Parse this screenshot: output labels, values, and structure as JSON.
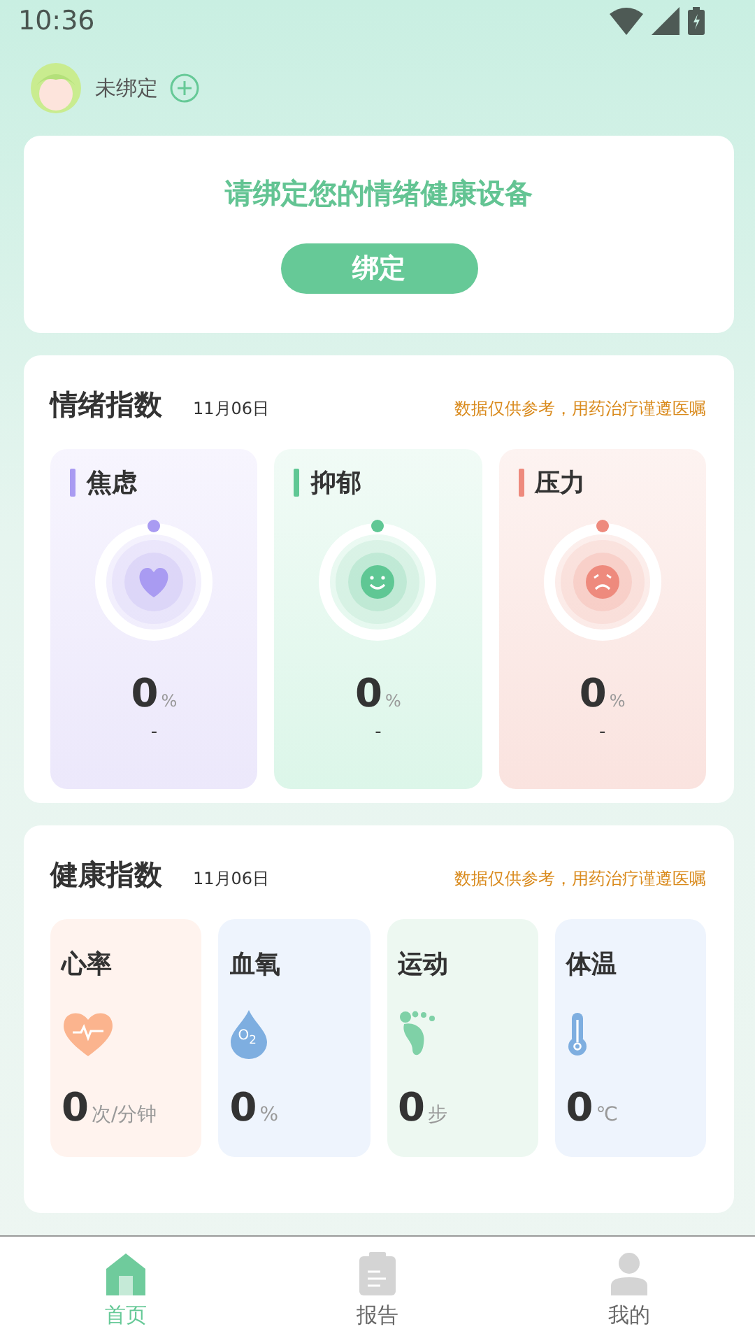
{
  "status_bar": {
    "time": "10:36"
  },
  "header": {
    "device_status": "未绑定"
  },
  "bind_card": {
    "prompt": "请绑定您的情绪健康设备",
    "button": "绑定"
  },
  "emotion_section": {
    "title": "情绪指数",
    "date": "11月06日",
    "disclaimer": "数据仅供参考，用药治疗谨遵医嘱",
    "items": [
      {
        "label": "焦虑",
        "kind": "heart",
        "color": "#a99bf2",
        "value": "0",
        "unit": "%",
        "note": "-"
      },
      {
        "label": "抑郁",
        "kind": "smile",
        "color": "#5fc794",
        "value": "0",
        "unit": "%",
        "note": "-"
      },
      {
        "label": "压力",
        "kind": "frown",
        "color": "#ee8a7d",
        "value": "0",
        "unit": "%",
        "note": "-"
      }
    ]
  },
  "health_section": {
    "title": "健康指数",
    "date": "11月06日",
    "disclaimer": "数据仅供参考，用药治疗谨遵医嘱",
    "items": [
      {
        "label": "心率",
        "kind": "heart",
        "value": "0",
        "unit": "次/分钟"
      },
      {
        "label": "血氧",
        "kind": "drop",
        "icon_text": "O$_{2}$",
        "value": "0",
        "unit": "%"
      },
      {
        "label": "运动",
        "kind": "foot",
        "value": "0",
        "unit": "步"
      },
      {
        "label": "体温",
        "kind": "thermometer",
        "value": "0",
        "unit": "℃"
      }
    ]
  },
  "bottom_nav": [
    {
      "label": "首页",
      "kind": "home",
      "selected": true
    },
    {
      "label": "报告",
      "kind": "report",
      "selected": false
    },
    {
      "label": "我的",
      "kind": "profile",
      "selected": false
    }
  ]
}
